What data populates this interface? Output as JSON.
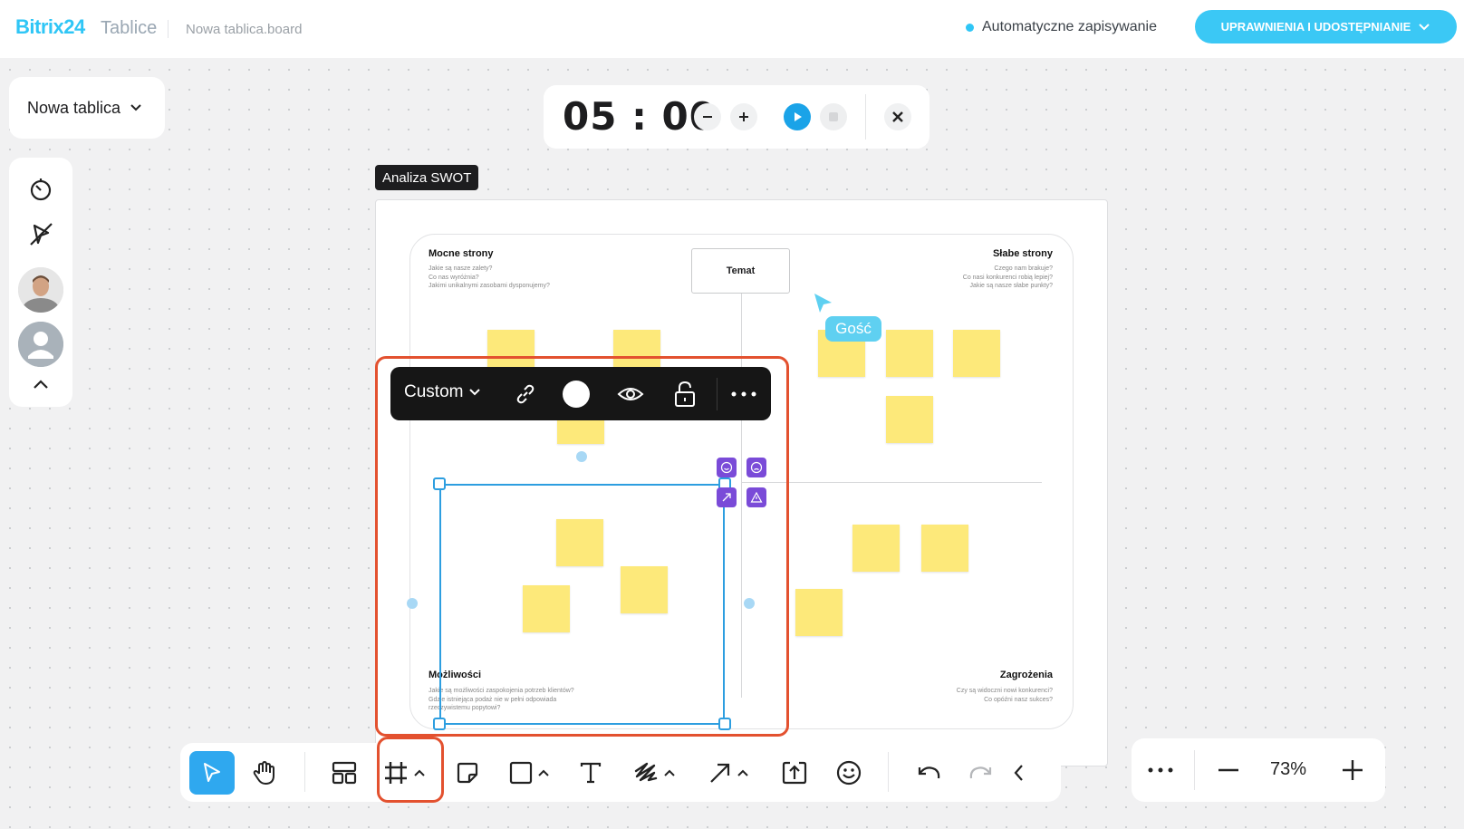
{
  "header": {
    "brand": "Bitrix24",
    "product": "Tablice",
    "file_name": "Nowa tablica.board",
    "autosave": "Automatyczne zapisywanie",
    "share_button": "UPRAWNIENIA I UDOSTĘPNIANIE"
  },
  "board_menu": {
    "label": "Nowa tablica"
  },
  "timer": {
    "display": "05 : 00"
  },
  "frame": {
    "label": "Analiza SWOT"
  },
  "swot": {
    "center": "Temat",
    "strengths": {
      "title": "Mocne strony",
      "lines": [
        "Jakie są nasze zalety?",
        "Co nas wyróżnia?",
        "Jakimi unikalnymi zasobami dysponujemy?"
      ]
    },
    "weaknesses": {
      "title": "Słabe strony",
      "lines": [
        "Czego nam brakuje?",
        "Co nasi konkurenci robią lepiej?",
        "Jakie są nasze słabe punkty?"
      ]
    },
    "opportunities": {
      "title": "Możliwości",
      "lines": [
        "Jakie są możliwości zaspokojenia potrzeb klientów?",
        "Gdzie istniejąca podaż nie w pełni odpowiada",
        "rzeczywistemu popytowi?"
      ]
    },
    "threats": {
      "title": "Zagrożenia",
      "lines": [
        "Czy są widoczni nowi konkurenci?",
        "Co opóźni nasz sukces?"
      ]
    }
  },
  "guest_cursor": {
    "label": "Gość"
  },
  "context_toolbar": {
    "preset": "Custom"
  },
  "zoom": {
    "value": "73%"
  },
  "colors": {
    "accent": "#2fc6f6",
    "sticky": "#fde97a",
    "highlight": "#e3512f",
    "selection": "#2d9ee0",
    "reaction": "#7a4bd8"
  }
}
